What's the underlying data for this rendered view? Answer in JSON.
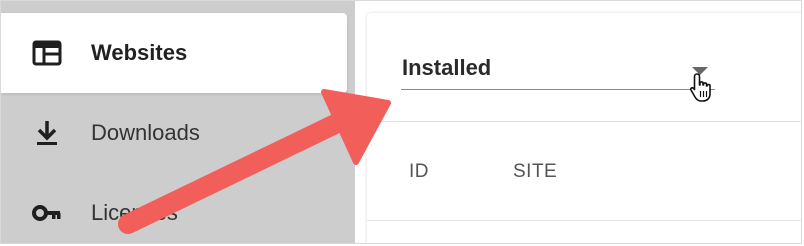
{
  "sidebar": {
    "items": [
      {
        "label": "Websites",
        "icon": "browser-window-icon",
        "active": true
      },
      {
        "label": "Downloads",
        "icon": "download-icon",
        "active": false
      },
      {
        "label": "Licenses",
        "icon": "key-icon",
        "active": false
      }
    ]
  },
  "main": {
    "filter": {
      "selected": "Installed"
    },
    "table": {
      "columns": [
        "ID",
        "SITE"
      ]
    }
  },
  "colors": {
    "sidebar_bg": "#cdcdcd",
    "active_bg": "#ffffff",
    "annotation_arrow": "#f25f5a",
    "text": "#333333"
  }
}
